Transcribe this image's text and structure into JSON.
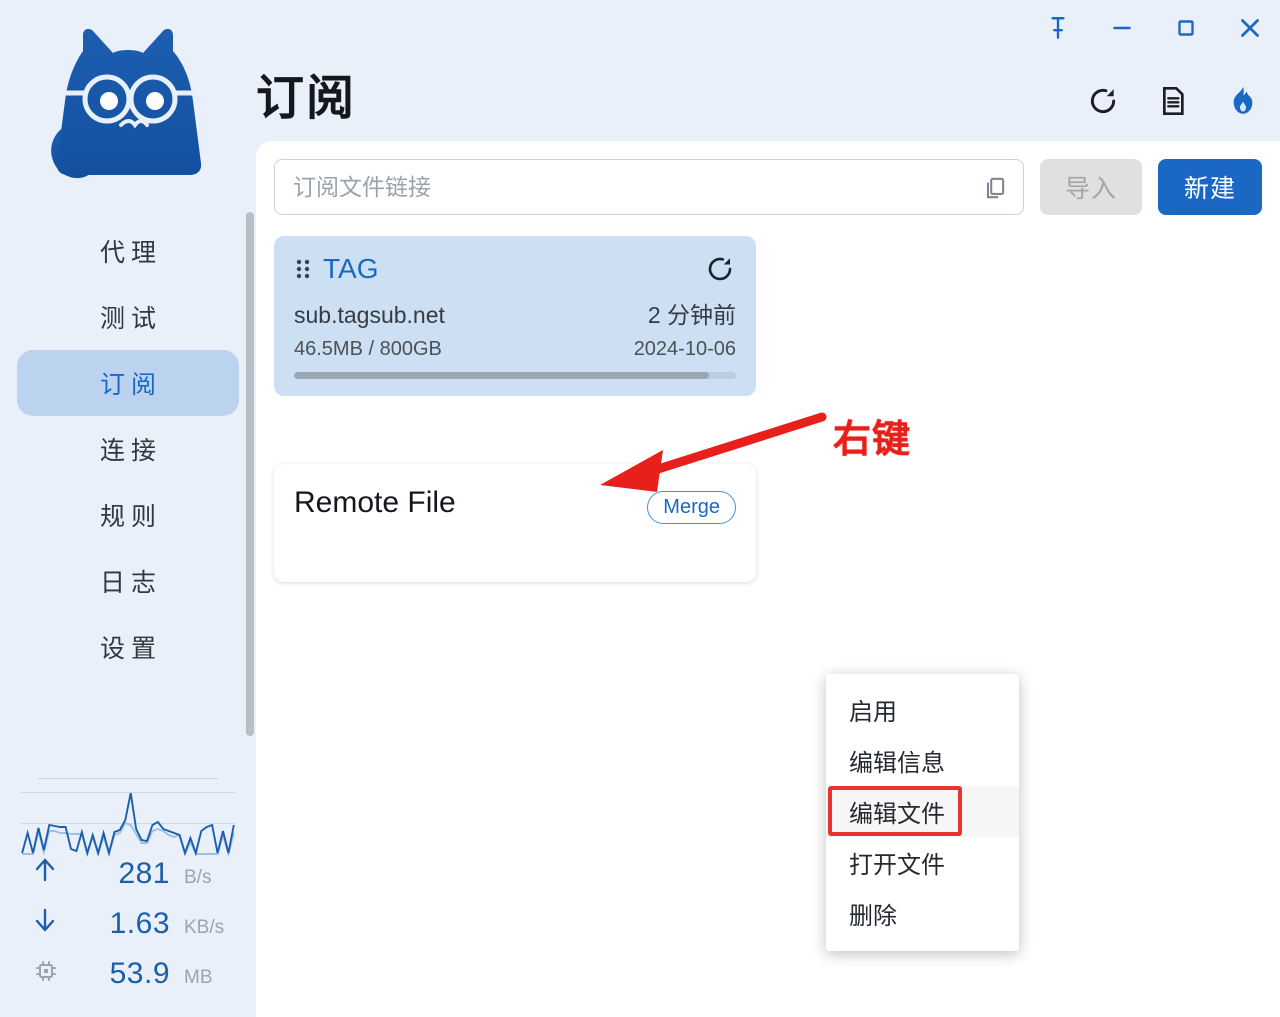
{
  "app": {
    "logo_icon": "cat-with-glasses-logo",
    "brand_color": "#1b5faa"
  },
  "window_controls": [
    {
      "name": "pin",
      "icon": "pin-icon"
    },
    {
      "name": "minimize",
      "icon": "minimize-icon"
    },
    {
      "name": "maximize",
      "icon": "maximize-icon"
    },
    {
      "name": "close",
      "icon": "close-icon"
    }
  ],
  "sidebar": {
    "items": [
      {
        "label": "代理",
        "key": "proxies",
        "active": false
      },
      {
        "label": "测试",
        "key": "test",
        "active": false
      },
      {
        "label": "订阅",
        "key": "profiles",
        "active": true
      },
      {
        "label": "连接",
        "key": "connections",
        "active": false
      },
      {
        "label": "规则",
        "key": "rules",
        "active": false
      },
      {
        "label": "日志",
        "key": "logs",
        "active": false
      },
      {
        "label": "设置",
        "key": "settings",
        "active": false
      }
    ],
    "stats": [
      {
        "icon": "arrow-up-icon",
        "value": "281",
        "unit": "B/s"
      },
      {
        "icon": "arrow-down-icon",
        "value": "1.63",
        "unit": "KB/s"
      },
      {
        "icon": "chip-icon",
        "value": "53.9",
        "unit": "MB"
      }
    ]
  },
  "header": {
    "title": "订阅",
    "tools": [
      {
        "name": "refresh",
        "icon": "refresh-icon"
      },
      {
        "name": "view-file",
        "icon": "document-icon"
      },
      {
        "name": "core-status",
        "icon": "flame-icon",
        "color": "#1b68c4"
      }
    ]
  },
  "toolbar": {
    "url_input": {
      "value": "",
      "placeholder": "订阅文件链接",
      "trailing_icon": "copy-icon"
    },
    "import_label": "导入",
    "import_disabled": true,
    "new_label": "新建"
  },
  "profiles": [
    {
      "kind": "subscription",
      "drag_handle_icon": "drag-dots-icon",
      "name": "TAG",
      "refresh_icon": "refresh-icon",
      "host": "sub.tagsub.net",
      "updated": "2 分钟前",
      "traffic": "46.5MB / 800GB",
      "expire": "2024-10-06",
      "progress_percent": 94,
      "selected": true
    },
    {
      "kind": "remote-file",
      "name": "Remote File",
      "badge": "Merge",
      "selected": false
    }
  ],
  "context_menu": {
    "items": [
      {
        "label": "启用",
        "highlighted": false
      },
      {
        "label": "编辑信息",
        "highlighted": false
      },
      {
        "label": "编辑文件",
        "highlighted": true
      },
      {
        "label": "打开文件",
        "highlighted": false
      },
      {
        "label": "删除",
        "highlighted": false
      }
    ]
  },
  "annotation": {
    "label": "右键",
    "color": "#e8201c",
    "highlight_box_color": "#e8332f"
  },
  "chart_data": {
    "type": "line",
    "title": "",
    "xlabel": "",
    "ylabel": "",
    "grid": true,
    "legend": "none",
    "series": [
      {
        "name": "上传",
        "color": "#1b5faa",
        "values": [
          2,
          22,
          2,
          27,
          5,
          30,
          29,
          28,
          28,
          6,
          4,
          23,
          2,
          20,
          2,
          22,
          2,
          23,
          25,
          35,
          62,
          26,
          15,
          14,
          30,
          33,
          26,
          24,
          22,
          20,
          2,
          17,
          2,
          24,
          28,
          30,
          2,
          24,
          2,
          30
        ]
      },
      {
        "name": "下载",
        "color": "#9dc0e4",
        "values": [
          1,
          1,
          1,
          24,
          3,
          24,
          24,
          22,
          22,
          21,
          21,
          21,
          1,
          18,
          1,
          18,
          1,
          20,
          22,
          32,
          30,
          21,
          12,
          12,
          24,
          26,
          24,
          20,
          18,
          20,
          1,
          13,
          1,
          1,
          1,
          1,
          1,
          20,
          1,
          22
        ]
      }
    ],
    "ylim": [
      0,
      66
    ]
  }
}
